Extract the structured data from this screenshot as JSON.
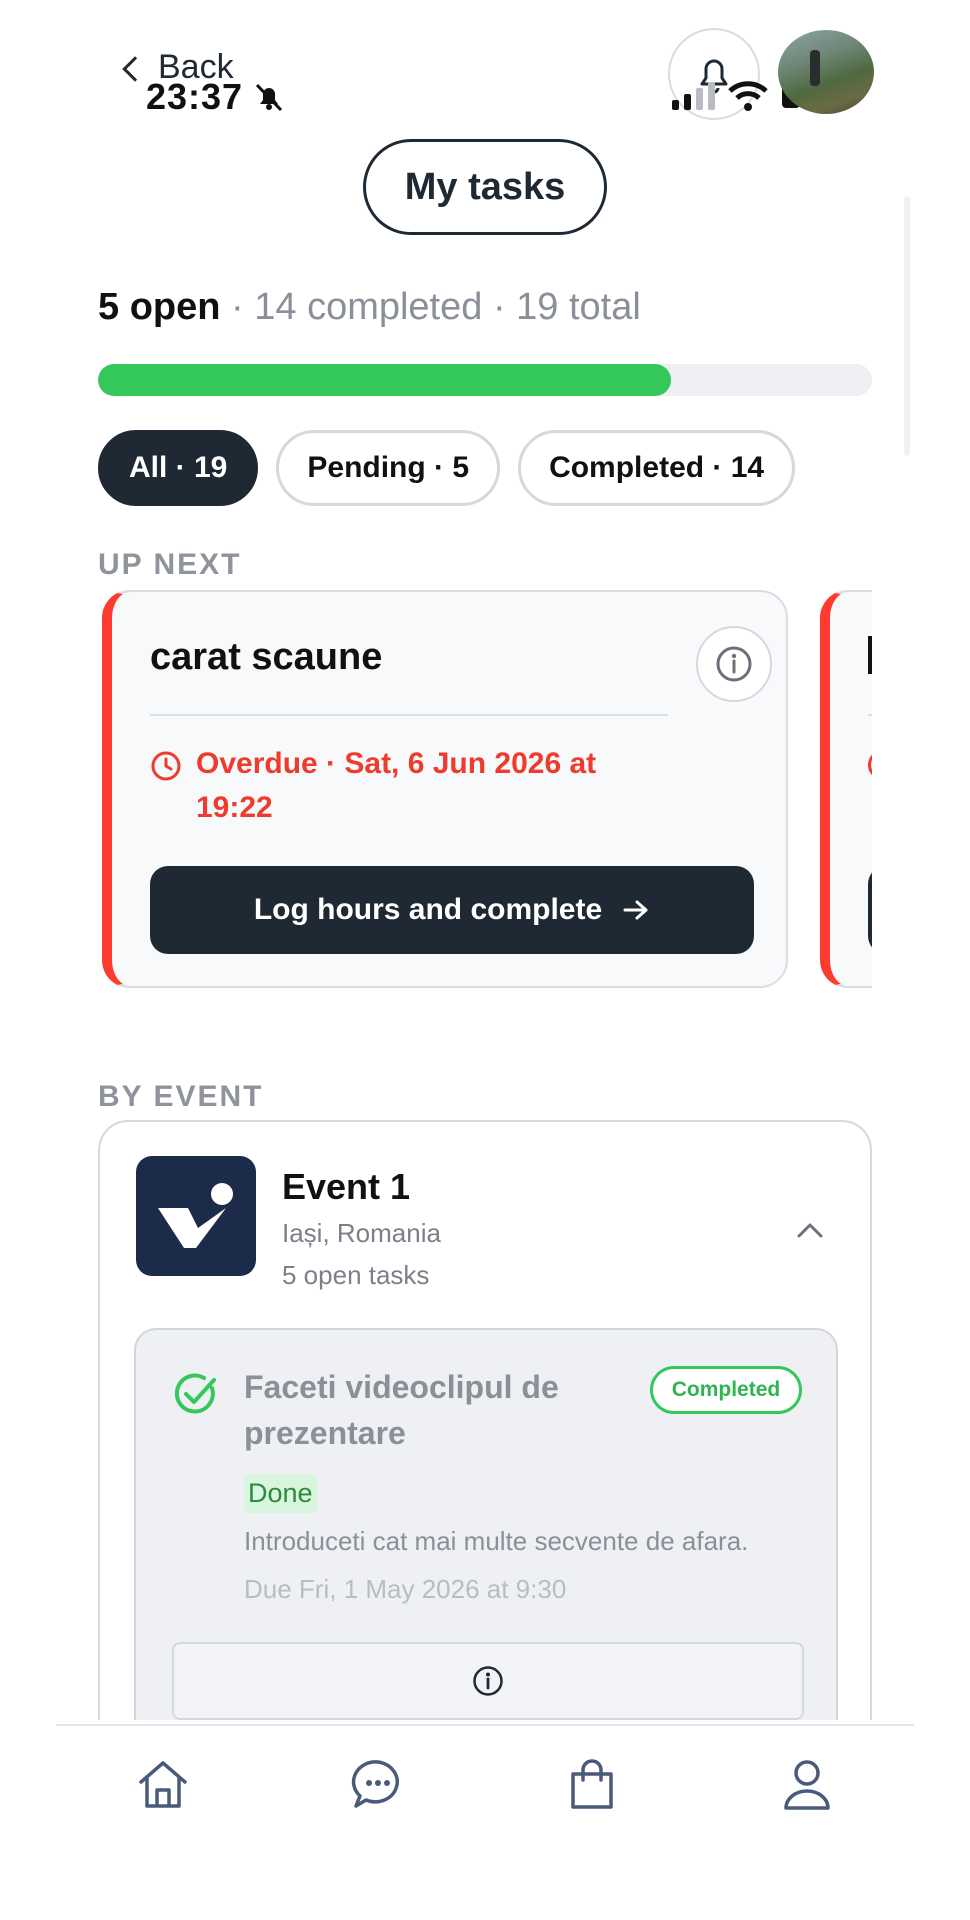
{
  "status_bar": {
    "time": "23:37"
  },
  "nav": {
    "back_label": "Back"
  },
  "header": {
    "title": "My tasks"
  },
  "summary": {
    "open": "5 open",
    "rest": " · 14 completed · 19 total",
    "progress_fraction": 0.74
  },
  "filters": [
    {
      "label": "All · 19",
      "active": true
    },
    {
      "label": "Pending · 5",
      "active": false
    },
    {
      "label": "Completed · 14",
      "active": false
    }
  ],
  "up_next": {
    "section_label": "UP NEXT",
    "cards": [
      {
        "title": "carat scaune",
        "due": "Overdue · Sat, 6 Jun 2026 at 19:22",
        "cta": "Log hours and complete"
      }
    ]
  },
  "by_event": {
    "section_label": "BY EVENT",
    "event": {
      "name": "Event 1",
      "location": "Iași, Romania",
      "open_tasks": "5 open tasks",
      "tasks": [
        {
          "title": "Faceti videoclipul de prezentare",
          "status_badge": "Completed",
          "done_label": "Done",
          "description": "Introduceti cat mai multe secvente de afara.",
          "due": "Due Fri, 1 May 2026 at 9:30"
        }
      ]
    }
  },
  "tabbar": {
    "items": [
      "home-icon",
      "chat-icon",
      "shop-icon",
      "profile-icon"
    ]
  },
  "colors": {
    "accent_dark": "#1f2933",
    "overdue": "#ef3b2d",
    "success": "#34c759"
  }
}
